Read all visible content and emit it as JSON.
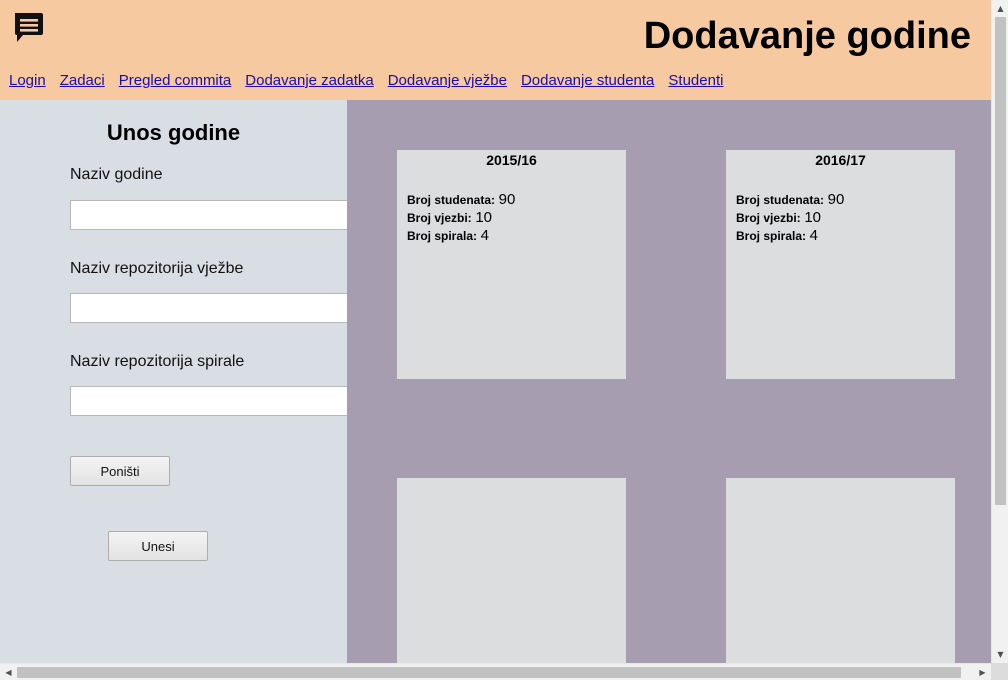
{
  "header": {
    "logo_icon": "chat-bubble-icon",
    "title": "Dodavanje godine",
    "background": "#f6c9a1"
  },
  "nav": {
    "items": [
      {
        "label": "Login"
      },
      {
        "label": "Zadaci"
      },
      {
        "label": "Pregled commita"
      },
      {
        "label": "Dodavanje zadatka"
      },
      {
        "label": "Dodavanje vježbe"
      },
      {
        "label": "Dodavanje studenta"
      },
      {
        "label": "Studenti"
      }
    ],
    "link_color": "#1a0dab"
  },
  "form": {
    "title": "Unos godine",
    "fields": [
      {
        "label": "Naziv godine",
        "value": "",
        "placeholder": ""
      },
      {
        "label": "Naziv repozitorija vježbe",
        "value": "",
        "placeholder": ""
      },
      {
        "label": "Naziv repozitorija spirale",
        "value": "",
        "placeholder": ""
      }
    ],
    "reset_label": "Poništi",
    "submit_label": "Unesi",
    "background": "#d9dde4"
  },
  "cards_area": {
    "background": "#a79db0",
    "cards": [
      {
        "title": "2015/16",
        "stats": [
          {
            "label": "Broj studenata:",
            "value": "90"
          },
          {
            "label": "Broj vjezbi:",
            "value": "10"
          },
          {
            "label": "Broj spirala:",
            "value": "4"
          }
        ]
      },
      {
        "title": "2016/17",
        "stats": [
          {
            "label": "Broj studenata:",
            "value": "90"
          },
          {
            "label": "Broj vjezbi:",
            "value": "10"
          },
          {
            "label": "Broj spirala:",
            "value": "4"
          }
        ]
      },
      {
        "title": "",
        "stats": []
      },
      {
        "title": "",
        "stats": []
      }
    ]
  },
  "scrollbars": {
    "up_icon": "arrow-up-icon",
    "down_icon": "arrow-down-icon",
    "left_icon": "arrow-left-icon",
    "right_icon": "arrow-right-icon"
  }
}
